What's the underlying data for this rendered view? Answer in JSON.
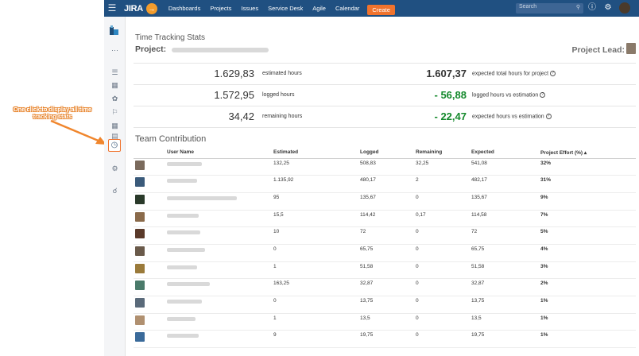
{
  "topbar": {
    "brand": "JIRA",
    "nav": [
      "Dashboards",
      "Projects",
      "Issues",
      "Service Desk",
      "Agile",
      "Calendar"
    ],
    "create_label": "Create",
    "search_placeholder": "Search",
    "colors": {
      "bar": "#205081",
      "create": "#f0732d"
    }
  },
  "annotation": {
    "text": "One click to display all time tracking stats",
    "color": "#e67e22"
  },
  "page": {
    "title": "Time Tracking Stats",
    "project_label": "Project:",
    "project_lead_label": "Project Lead:"
  },
  "stats": [
    {
      "value": "1.629,83",
      "label": "estimated hours",
      "value2": "1.607,37",
      "label2": "expected total hours for project",
      "color2": "#333333"
    },
    {
      "value": "1.572,95",
      "label": "logged hours",
      "value2": "- 56,88",
      "label2": "logged hours vs estimation",
      "color2": "#14892c"
    },
    {
      "value": "34,42",
      "label": "remaining hours",
      "value2": "- 22,47",
      "label2": "expected hours vs estimation",
      "color2": "#14892c"
    }
  ],
  "team": {
    "title": "Team Contribution",
    "headers": [
      "User Name",
      "Estimated",
      "Logged",
      "Remaining",
      "Expected",
      "Project Effort (%) ▴"
    ],
    "rows": [
      {
        "estimated": "132,25",
        "logged": "508,83",
        "remaining": "32,25",
        "expected": "541,08",
        "effort": "32%",
        "avatar": "#7a6a5c"
      },
      {
        "estimated": "1.135,92",
        "logged": "480,17",
        "remaining": "2",
        "expected": "482,17",
        "effort": "31%",
        "avatar": "#3a5a7a"
      },
      {
        "estimated": "95",
        "logged": "135,67",
        "remaining": "0",
        "expected": "135,67",
        "effort": "9%",
        "avatar": "#2a3a2a"
      },
      {
        "estimated": "15,5",
        "logged": "114,42",
        "remaining": "0,17",
        "expected": "114,58",
        "effort": "7%",
        "avatar": "#8a6a4a"
      },
      {
        "estimated": "10",
        "logged": "72",
        "remaining": "0",
        "expected": "72",
        "effort": "5%",
        "avatar": "#5a3a2a"
      },
      {
        "estimated": "0",
        "logged": "65,75",
        "remaining": "0",
        "expected": "65,75",
        "effort": "4%",
        "avatar": "#6a5a4a"
      },
      {
        "estimated": "1",
        "logged": "51,58",
        "remaining": "0",
        "expected": "51,58",
        "effort": "3%",
        "avatar": "#9a7a3a"
      },
      {
        "estimated": "163,25",
        "logged": "32,87",
        "remaining": "0",
        "expected": "32,87",
        "effort": "2%",
        "avatar": "#4a7a6a"
      },
      {
        "estimated": "0",
        "logged": "13,75",
        "remaining": "0",
        "expected": "13,75",
        "effort": "1%",
        "avatar": "#5a6a7a"
      },
      {
        "estimated": "1",
        "logged": "13,5",
        "remaining": "0",
        "expected": "13,5",
        "effort": "1%",
        "avatar": "#b09070"
      },
      {
        "estimated": "9",
        "logged": "19,75",
        "remaining": "0",
        "expected": "19,75",
        "effort": "1%",
        "avatar": "#3a6a9a"
      }
    ]
  }
}
